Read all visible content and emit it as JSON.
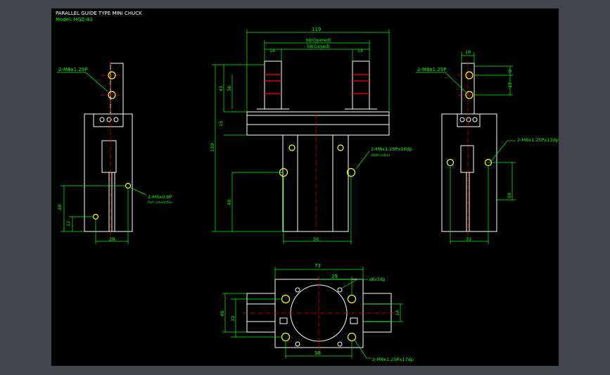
{
  "title": {
    "line1": "PARALLEL GUIDE TYPE MINI CHUCK",
    "line2": "Model: HGZ-40"
  },
  "left_view": {
    "callout_thread": "2-M8x1.25P",
    "callout_port": "2-M5x0.8P",
    "callout_port_sub": "Port connection",
    "dims": {
      "height_38": "38",
      "height_12": "12",
      "width_28": "28"
    }
  },
  "front_view": {
    "dims": {
      "width_119": "119",
      "open_dim": "66(Opened)",
      "closed_dim": "58(Closed)",
      "jaw_left": "14",
      "jaw_right": "14",
      "h41": "41",
      "h36": "36",
      "h15": "15",
      "h139": "139",
      "h48": "48",
      "base_56": "56"
    },
    "callout_thread": "2-M8x1.25Px16dp",
    "callout_sub": "(Both sides)"
  },
  "right_view": {
    "callout_thread_top": "2-M8x1.25P",
    "callout_thread_side": "2-M8x1.25Px13dp",
    "dims": {
      "w18": "18",
      "h9": "9",
      "h17": "17",
      "h58": "58",
      "base_32": "32"
    }
  },
  "bottom_view": {
    "dims": {
      "w73": "73",
      "w29": "29",
      "h46": "46",
      "h32": "32",
      "h14": "14",
      "base_58": "58"
    },
    "callout_hole": "ø6x5dp",
    "callout_thread": "2-M8x1.25Px17dp"
  },
  "colors": {
    "frame": "#42454c",
    "canvas": "#000000",
    "line": "#ffffff",
    "dim": "#00ff00",
    "center": "#ff0000",
    "hole": "#ffff00"
  }
}
